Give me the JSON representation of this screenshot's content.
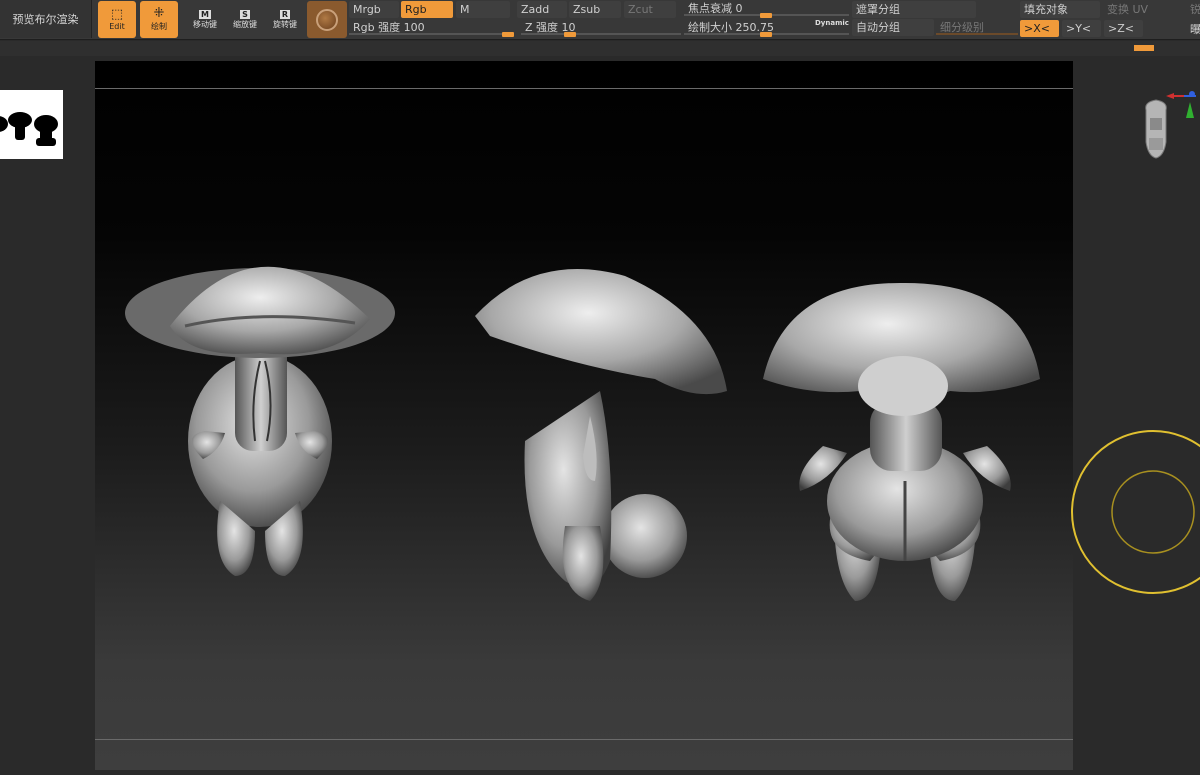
{
  "toolbar": {
    "preview_label": "预览布尔渲染",
    "modes": [
      {
        "label": "Edit",
        "active": true
      },
      {
        "label": "绘制",
        "active": true
      },
      {
        "label": "移动键",
        "key": "M",
        "active": false
      },
      {
        "label": "缩放键",
        "key": "S",
        "active": false
      },
      {
        "label": "旋转键",
        "key": "R",
        "active": false
      }
    ],
    "mrgb": "Mrgb",
    "rgb": "Rgb",
    "m": "M",
    "rgb_intensity": "Rgb 强度 100",
    "zadd": "Zadd",
    "zsub": "Zsub",
    "zcut": "Zcut",
    "z_intensity": "Z 强度 10",
    "focal_shift": "焦点衰减 0",
    "draw_size": "绘制大小 250.75",
    "dynamic": "Dynamic",
    "mask_groups": "遮罩分组",
    "auto_groups": "自动分组",
    "subdiv_level": "细分级别",
    "fill_object": "填充对象",
    "transform_uv": "变换 UV",
    "sym_x": ">X<",
    "sym_y": ">Y<",
    "sym_z": ">Z<",
    "edge_cut_left": "锐",
    "edge_cut_right": "曝"
  },
  "sliders": {
    "rgb_intensity": 1.0,
    "z_intensity": 0.1,
    "focal_shift": 0.5,
    "draw_size": 0.47
  },
  "colors": {
    "accent": "#f09a3a",
    "gizmo": "#e0c030",
    "axis_x": "#d03030",
    "axis_y": "#30b030",
    "axis_z": "#3060e0"
  }
}
